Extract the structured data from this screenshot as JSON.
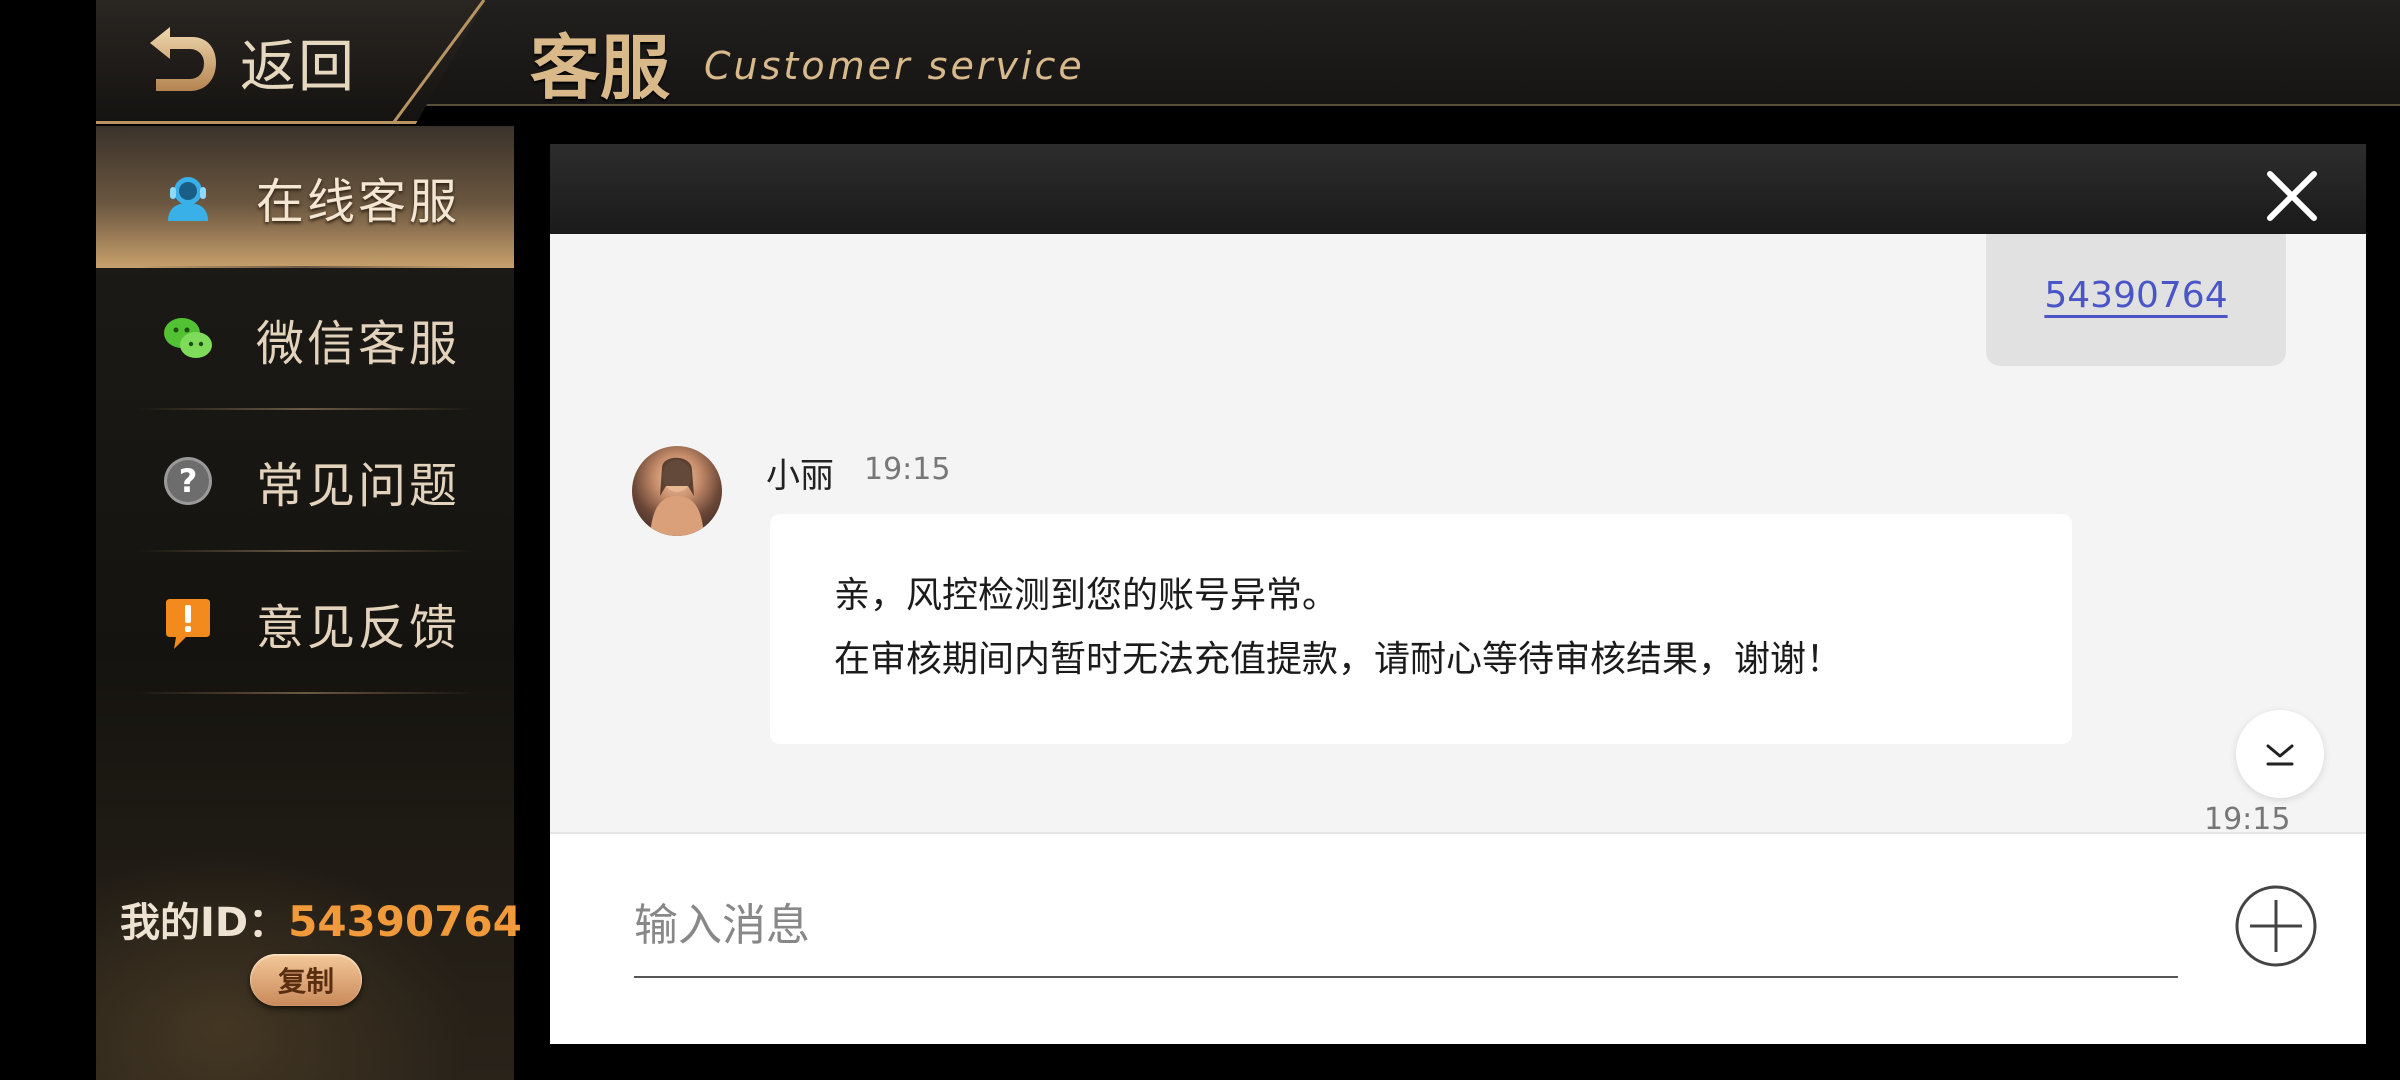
{
  "header": {
    "back_label": "返回",
    "title_cn": "客服",
    "title_en": "Customer service"
  },
  "sidebar": {
    "items": [
      {
        "label": "在线客服",
        "icon": "online-service-icon",
        "active": true
      },
      {
        "label": "微信客服",
        "icon": "wechat-icon",
        "active": false
      },
      {
        "label": "常见问题",
        "icon": "question-icon",
        "active": false
      },
      {
        "label": "意见反馈",
        "icon": "feedback-icon",
        "active": false
      }
    ],
    "my_id_label": "我的ID：",
    "my_id_value": "54390764",
    "copy_label": "复制"
  },
  "chat": {
    "sent_message": "54390764",
    "agent_name": "小丽",
    "agent_time": "19:15",
    "agent_message_lines": [
      "亲，风控检测到您的账号异常。",
      "在审核期间内暂时无法充值提款，请耐心等待审核结果，谢谢！"
    ],
    "bottom_time": "19:15",
    "input_placeholder": "输入消息"
  },
  "colors": {
    "accent_gold": "#d9b889",
    "id_orange": "#f09a3c",
    "link_blue": "#4a56c8"
  }
}
